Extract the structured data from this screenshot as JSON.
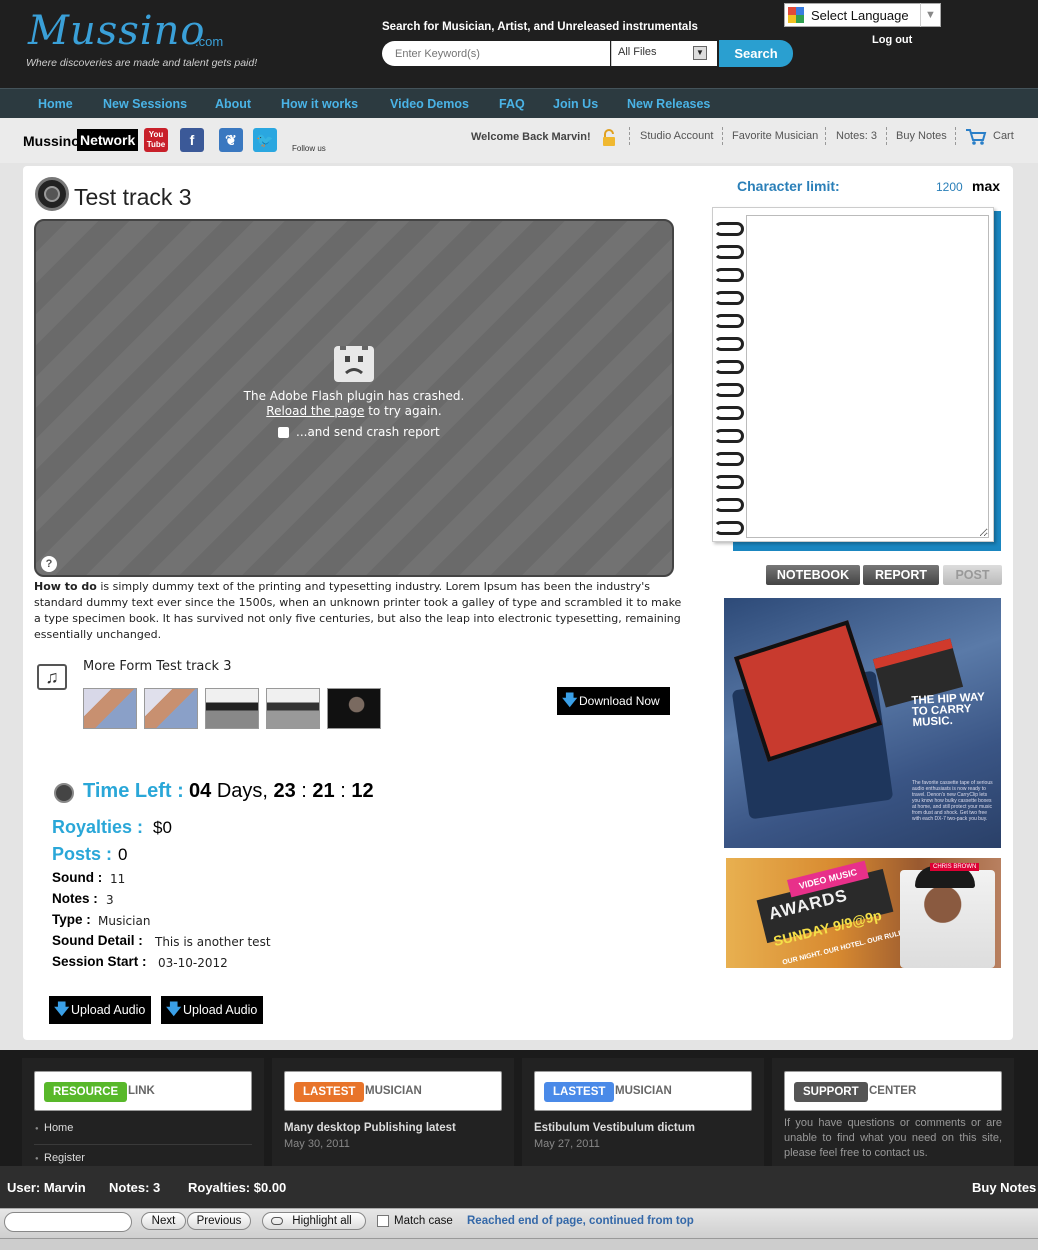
{
  "header": {
    "logo": "Mussino",
    "logo_suffix": ".com",
    "tagline": "Where discoveries are made and talent gets paid!",
    "search_label": "Search for Musician, Artist, and Unreleased instrumentals",
    "search_placeholder": "Enter Keyword(s)",
    "search_filter": "All Files",
    "search_button": "Search",
    "language": "Select Language",
    "logout": "Log out"
  },
  "nav": [
    "Home",
    "New Sessions",
    "About",
    "How it works",
    "Video Demos",
    "FAQ",
    "Join Us",
    "New Releases"
  ],
  "network": {
    "label_1": "Mussino",
    "label_2": "Network",
    "follow": "Follow us",
    "youtube_label": "You Tube"
  },
  "account": {
    "welcome": "Welcome Back Marvin!",
    "links": [
      "Studio Account",
      "Favorite Musician",
      "Notes: 3",
      "Buy Notes",
      "Cart"
    ]
  },
  "track": {
    "title": "Test track 3",
    "flash_line1": "The Adobe Flash plugin has crashed.",
    "flash_reload": "Reload the page",
    "flash_line2_rest": " to try again.",
    "flash_report": "...and send crash report",
    "flash_help": "?",
    "desc_bold": "How to do",
    "desc_text": " is simply dummy text of the printing and typesetting industry. Lorem Ipsum has been the industry's standard dummy text ever since the 1500s, when an unknown printer took a galley of type and scrambled it to make a type specimen book. It has survived not only five centuries, but also the leap into electronic typesetting, remaining essentially unchanged.",
    "more_title": "More Form Test track 3",
    "download": "Download Now"
  },
  "session": {
    "time_left_label": "Time Left :",
    "days": "04",
    "days_label": "Days,",
    "hours": "23",
    "minutes": "21",
    "seconds": "12",
    "royalties_label": "Royalties :",
    "royalties": "$0",
    "posts_label": "Posts :",
    "posts": "0",
    "sound_label": "Sound :",
    "sound": "11",
    "notes_label": "Notes :",
    "notes": "3",
    "type_label": "Type :",
    "type": "Musician",
    "detail_label": "Sound Detail :",
    "detail": "This is another test",
    "start_label": "Session Start :",
    "start": "03-10-2012",
    "upload_1": "Upload Audio",
    "upload_2": "Upload Audio"
  },
  "sidebar": {
    "char_limit_label": "Character limit:",
    "char_limit": "1200",
    "char_max": "max",
    "tabs": [
      "NOTEBOOK",
      "REPORT",
      "POST"
    ],
    "ad1_text": "THE HIP WAY TO CARRY MUSIC.",
    "ad1_small": "The favorite cassette tape of serious audio enthusiasts is now ready to travel. Denon's new CarryClip lets you know how bulky cassette boxes at home, and still protect your music from dust and shock. Get two free with each DX-7 two-pack you buy.",
    "ad2_top": "VIDEO MUSIC",
    "ad2_awards": "AWARDS",
    "ad2_date": "SUNDAY 9/9@9p",
    "ad2_tag": "OUR NIGHT. OUR HOTEL. OUR RULES. LIVE! VEGAS!",
    "ad2_artist": "CHRIS BROWN"
  },
  "footer": {
    "resource_badge": "RESOURCE",
    "resource_head": "LINK",
    "resource_links": [
      "Home",
      "Register"
    ],
    "lastest1_badge": "LASTEST",
    "lastest1_head": "MUSICIAN",
    "lastest1_title": "Many desktop Publishing latest",
    "lastest1_date": "May 30, 2011",
    "lastest2_badge": "LASTEST",
    "lastest2_head": "MUSICIAN",
    "lastest2_title": "Estibulum Vestibulum dictum",
    "lastest2_date": "May 27, 2011",
    "support_badge": "SUPPORT",
    "support_head": "CENTER",
    "support_text": "If you have questions or comments or are unable to find what you need on this site, please feel free to contact us."
  },
  "statusbar": {
    "user": "User: Marvin",
    "notes": "Notes: 3",
    "royalties": "Royalties: $0.00",
    "buy_notes": "Buy Notes"
  },
  "findbar": {
    "next": "Next",
    "previous": "Previous",
    "highlight": "Highlight all",
    "match_case": "Match case",
    "status": "Reached end of page, continued from top"
  }
}
